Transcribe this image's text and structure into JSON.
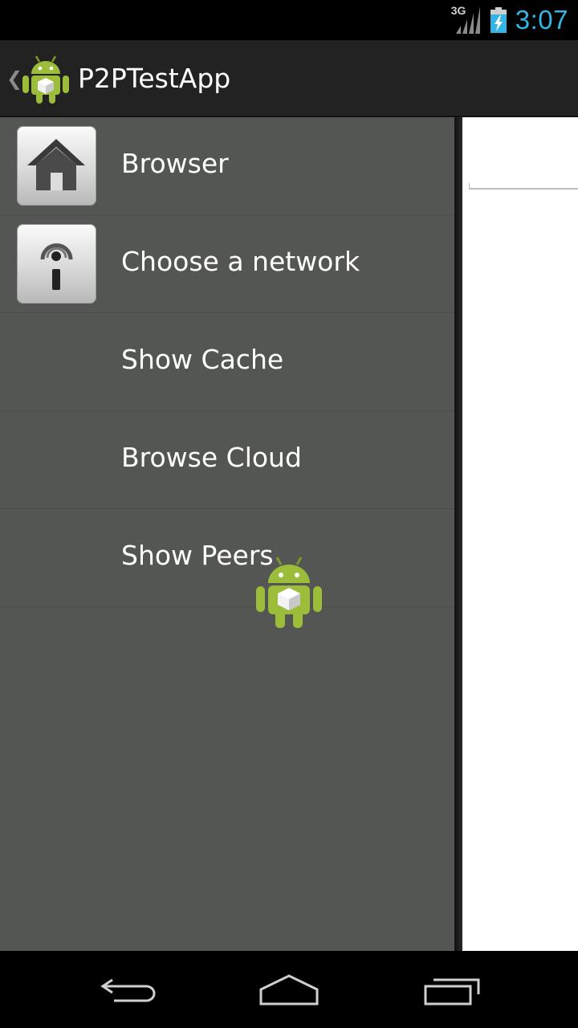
{
  "status_bar": {
    "network_type": "3G",
    "time": "3:07",
    "icons": [
      "signal-icon",
      "battery-charging-icon"
    ]
  },
  "action_bar": {
    "title": "P2PTestApp",
    "logo_icon": "android-app-icon"
  },
  "drawer": {
    "items": [
      {
        "label": "Browser",
        "icon": "home-icon"
      },
      {
        "label": "Choose a network",
        "icon": "info-icon"
      },
      {
        "label": "Show Cache",
        "icon": null
      },
      {
        "label": "Browse Cloud",
        "icon": null
      },
      {
        "label": "Show Peers",
        "icon": null
      }
    ]
  },
  "nav_bar": {
    "buttons": [
      "back-icon",
      "home-nav-icon",
      "recent-apps-icon"
    ]
  },
  "colors": {
    "clock": "#33b5e5",
    "drawer_bg": "#545653",
    "action_bar_bg": "#222222",
    "android_green": "#9bbd3a"
  }
}
